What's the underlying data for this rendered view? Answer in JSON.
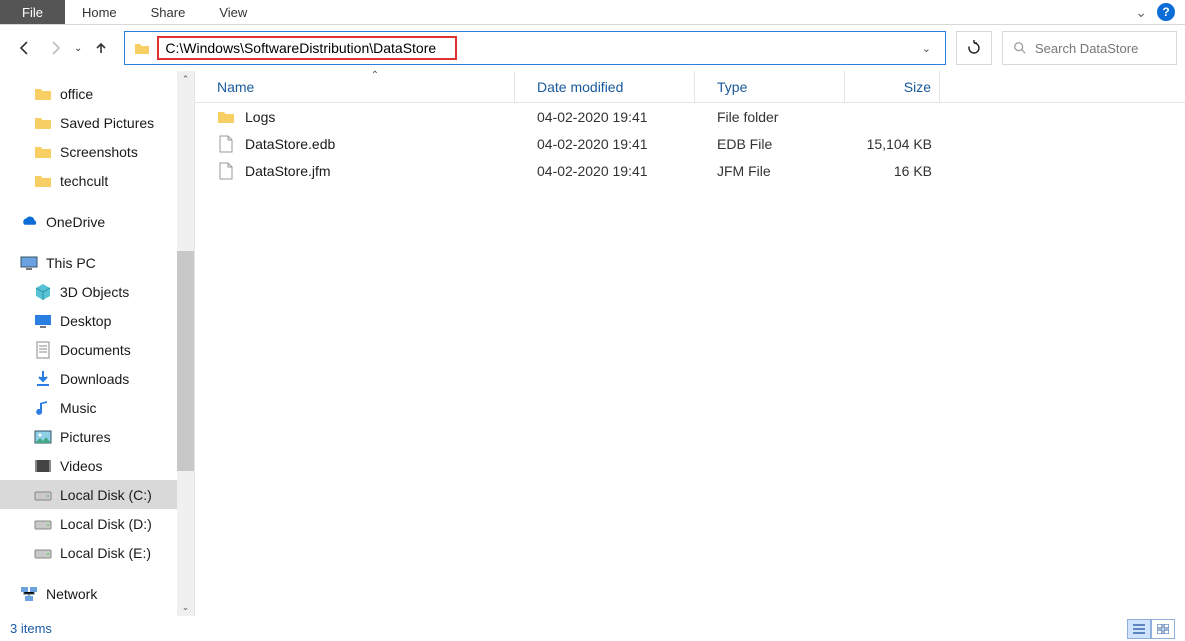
{
  "ribbon": {
    "tabs": [
      "File",
      "Home",
      "Share",
      "View"
    ]
  },
  "address": {
    "path": "C:\\Windows\\SoftwareDistribution\\DataStore"
  },
  "search": {
    "placeholder": "Search DataStore"
  },
  "tree": {
    "quick": [
      {
        "label": "office",
        "icon": "folder"
      },
      {
        "label": "Saved Pictures",
        "icon": "folder"
      },
      {
        "label": "Screenshots",
        "icon": "folder"
      },
      {
        "label": "techcult",
        "icon": "folder"
      }
    ],
    "onedrive": {
      "label": "OneDrive"
    },
    "thispc": {
      "label": "This PC",
      "children": [
        {
          "label": "3D Objects",
          "icon": "3d"
        },
        {
          "label": "Desktop",
          "icon": "desktop"
        },
        {
          "label": "Documents",
          "icon": "doc"
        },
        {
          "label": "Downloads",
          "icon": "download"
        },
        {
          "label": "Music",
          "icon": "music"
        },
        {
          "label": "Pictures",
          "icon": "picture"
        },
        {
          "label": "Videos",
          "icon": "video"
        },
        {
          "label": "Local Disk (C:)",
          "icon": "disk",
          "selected": true
        },
        {
          "label": "Local Disk (D:)",
          "icon": "disk"
        },
        {
          "label": "Local Disk (E:)",
          "icon": "disk"
        }
      ]
    },
    "network": {
      "label": "Network"
    }
  },
  "columns": {
    "name": "Name",
    "date": "Date modified",
    "type": "Type",
    "size": "Size"
  },
  "rows": [
    {
      "name": "Logs",
      "date": "04-02-2020 19:41",
      "type": "File folder",
      "size": "",
      "icon": "folder"
    },
    {
      "name": "DataStore.edb",
      "date": "04-02-2020 19:41",
      "type": "EDB File",
      "size": "15,104 KB",
      "icon": "file"
    },
    {
      "name": "DataStore.jfm",
      "date": "04-02-2020 19:41",
      "type": "JFM File",
      "size": "16 KB",
      "icon": "file"
    }
  ],
  "status": {
    "text": "3 items"
  }
}
